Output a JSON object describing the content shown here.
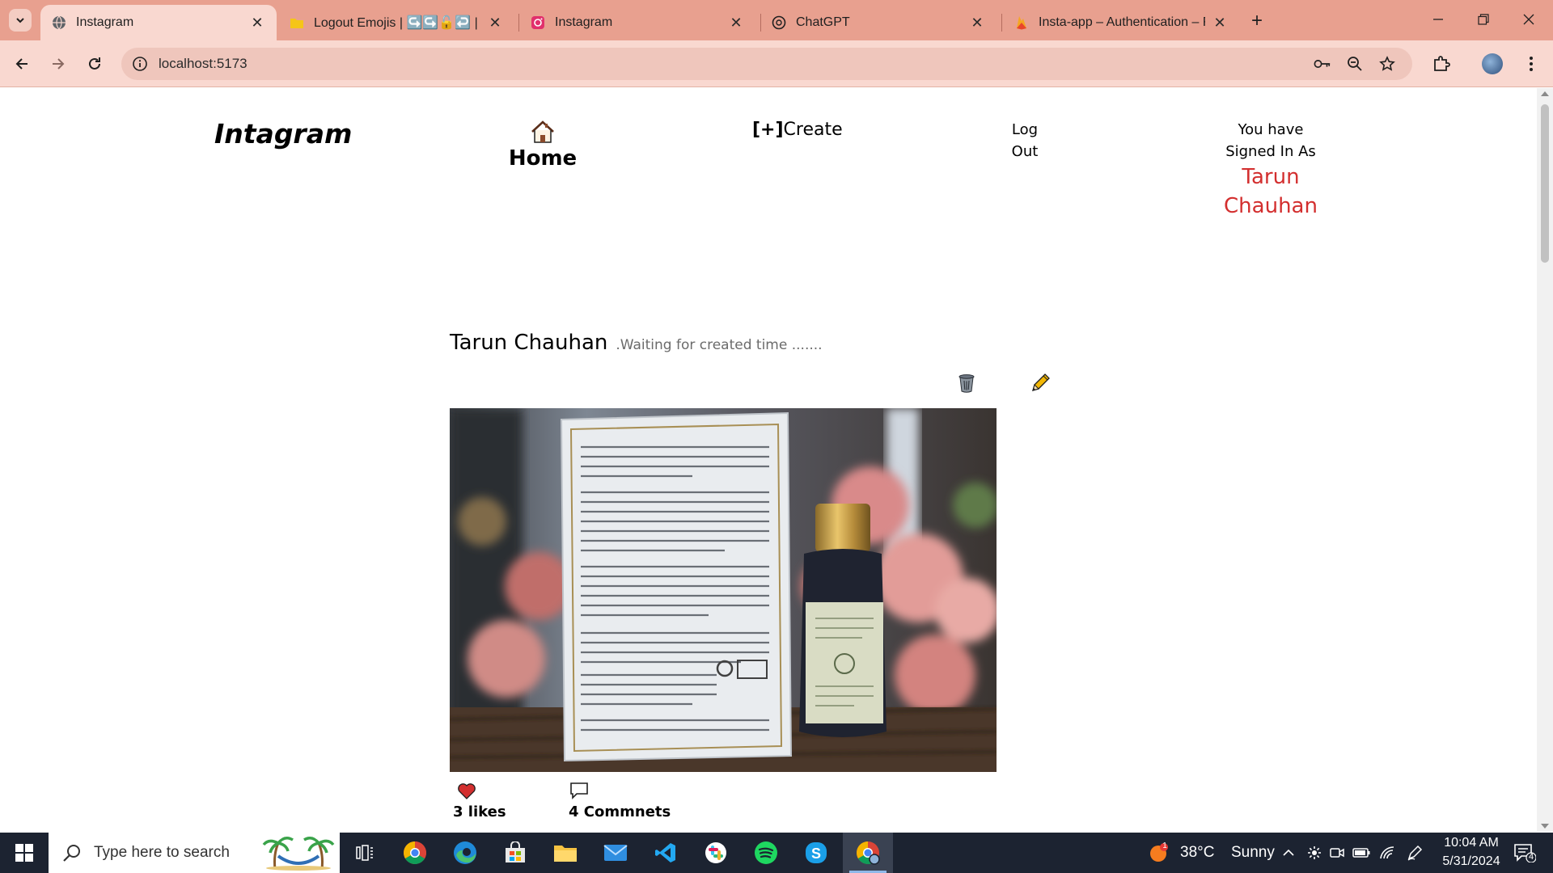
{
  "browser": {
    "tabs": [
      {
        "title": "Instagram",
        "favicon": "globe-icon",
        "active": true
      },
      {
        "title": "Logout Emojis | ↪️↪️🔓↩️ | Copy",
        "favicon": "folder-icon",
        "active": false
      },
      {
        "title": "Instagram",
        "favicon": "instagram-icon",
        "active": false
      },
      {
        "title": "ChatGPT",
        "favicon": "chatgpt-icon",
        "active": false
      },
      {
        "title": "Insta-app – Authentication – Fir",
        "favicon": "firebase-icon",
        "active": false
      }
    ],
    "url": "localhost:5173",
    "colors": {
      "tabstrip": "#e8a08f",
      "toolbar": "#f9d8d0"
    }
  },
  "app": {
    "brand": "Intagram",
    "nav": {
      "home_label": "Home",
      "create_bracket": "[+]",
      "create_label": "Create",
      "logout_line1": "Log",
      "logout_line2": "Out",
      "signed_line1": "You have",
      "signed_line2": "Signed In As",
      "user_first": "Tarun",
      "user_last": "Chauhan"
    },
    "post": {
      "author": "Tarun Chauhan",
      "time": ".Waiting for created time .......",
      "likes": "3 likes",
      "comments": "4 Commnets"
    },
    "colors": {
      "username": "#d32f2f",
      "heart": "#d32f2f",
      "pencil": "#f2b705"
    }
  },
  "taskbar": {
    "search_placeholder": "Type here to search",
    "weather_temp": "38°C",
    "weather_text": "Sunny",
    "weather_badge": "1",
    "time": "10:04 AM",
    "date": "5/31/2024",
    "notif_count": "4",
    "apps": [
      "task-view-icon",
      "chrome-icon",
      "edge-icon",
      "store-icon",
      "explorer-icon",
      "mail-icon",
      "vscode-icon",
      "slack-icon",
      "spotify-icon",
      "skype-icon",
      "chrome-profile-icon"
    ]
  }
}
